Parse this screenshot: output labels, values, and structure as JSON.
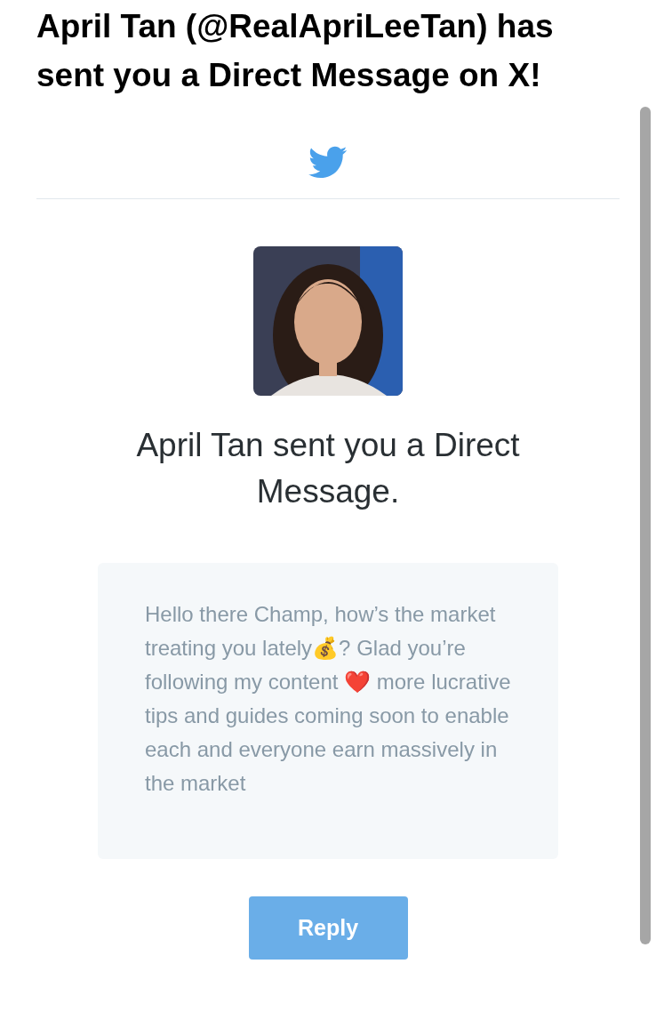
{
  "email": {
    "subject": "April Tan (@RealApriLeeTan) has sent you a Direct Message on X!"
  },
  "card": {
    "headline": "April Tan sent you a Direct Message.",
    "message": "Hello there Champ, how’s the market treating you lately💰? Glad you’re following my content ❤️ more lucrative tips and guides coming soon to enable each and everyone earn massively in the market",
    "button": "Reply"
  }
}
